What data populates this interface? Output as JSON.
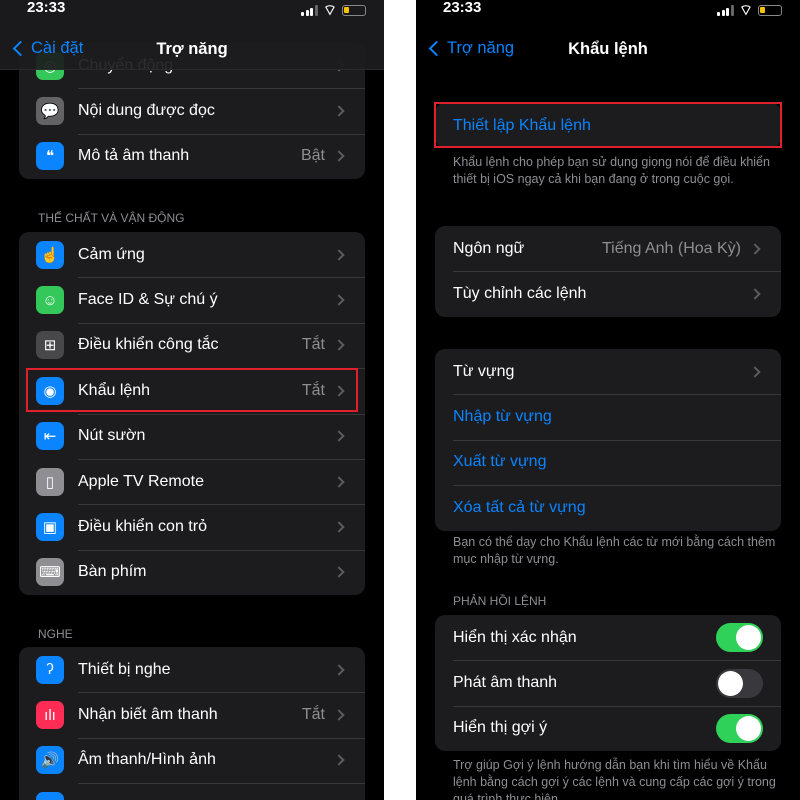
{
  "left": {
    "status": {
      "time": "23:33"
    },
    "nav": {
      "back": "Cài đặt",
      "title": "Trợ năng"
    },
    "group0": [
      {
        "label": "Chuyển động",
        "icon": "motion-icon",
        "color": "#34c759"
      },
      {
        "label": "Nội dung được đọc",
        "icon": "spoken-content-icon",
        "color": "#636366"
      },
      {
        "label": "Mô tả âm thanh",
        "value": "Bật",
        "icon": "audio-description-icon",
        "color": "#0a84ff"
      }
    ],
    "section1": "THỂ CHẤT VÀ VẬN ĐỘNG",
    "group1": [
      {
        "label": "Cảm ứng",
        "icon": "touch-icon",
        "color": "#0a84ff"
      },
      {
        "label": "Face ID & Sự chú ý",
        "icon": "face-id-icon",
        "color": "#34c759"
      },
      {
        "label": "Điều khiển công tắc",
        "value": "Tắt",
        "icon": "switch-control-icon",
        "color": "#48484a"
      },
      {
        "label": "Khẩu lệnh",
        "value": "Tắt",
        "icon": "voice-control-icon",
        "color": "#0a84ff"
      },
      {
        "label": "Nút sườn",
        "icon": "side-button-icon",
        "color": "#0a84ff"
      },
      {
        "label": "Apple TV Remote",
        "icon": "tv-remote-icon",
        "color": "#8e8e93"
      },
      {
        "label": "Điều khiển con trỏ",
        "icon": "pointer-control-icon",
        "color": "#0a84ff"
      },
      {
        "label": "Bàn phím",
        "icon": "keyboard-icon",
        "color": "#8e8e93"
      }
    ],
    "section2": "NGHE",
    "group2": [
      {
        "label": "Thiết bị nghe",
        "icon": "hearing-icon",
        "color": "#0a84ff"
      },
      {
        "label": "Nhận biết âm thanh",
        "value": "Tắt",
        "icon": "sound-recognition-icon",
        "color": "#ff2d55"
      },
      {
        "label": "Âm thanh/Hình ảnh",
        "icon": "audio-visual-icon",
        "color": "#0a84ff"
      },
      {
        "label": "",
        "icon": "subtitles-icon",
        "color": "#0a84ff"
      }
    ]
  },
  "right": {
    "status": {
      "time": "23:33"
    },
    "nav": {
      "back": "Trợ năng",
      "title": "Khẩu lệnh"
    },
    "setup": "Thiết lập Khẩu lệnh",
    "setup_footer": "Khẩu lệnh cho phép bạn sử dụng giọng nói để điều khiển thiết bị iOS ngay cả khi bạn đang ở trong cuộc gọi.",
    "language": {
      "label": "Ngôn ngữ",
      "value": "Tiếng Anh (Hoa Kỳ)"
    },
    "customize": "Tùy chỉnh các lệnh",
    "vocab": {
      "label": "Từ vựng",
      "import": "Nhập từ vựng",
      "export": "Xuất từ vựng",
      "delete": "Xóa tất cả từ vựng"
    },
    "vocab_footer": "Bạn có thể dạy cho Khẩu lệnh các từ mới bằng cách thêm mục nhập từ vựng.",
    "feedback_header": "PHẢN HỒI LỆNH",
    "toggles": [
      {
        "label": "Hiển thị xác nhận",
        "on": true
      },
      {
        "label": "Phát âm thanh",
        "on": false
      },
      {
        "label": "Hiển thị gợi ý",
        "on": true
      }
    ],
    "feedback_footer": "Trợ giúp Gợi ý lệnh hướng dẫn bạn khi tìm hiểu về Khẩu lệnh bằng cách gợi ý các lệnh và cung cấp các gợi ý trong quá trình thực hiện.",
    "toggle_on_color": "#30d158"
  },
  "highlight_color": "#e0202a"
}
